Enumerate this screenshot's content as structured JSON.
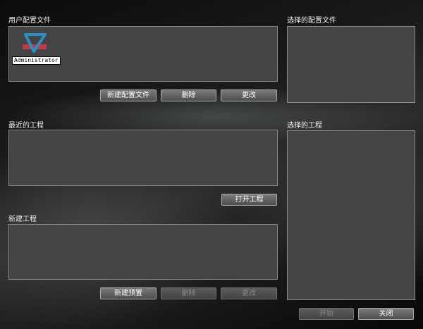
{
  "user_profiles": {
    "label": "用户配置文件",
    "profiles": [
      {
        "name": "Administrator",
        "icon": "playback-logo-icon"
      }
    ],
    "buttons": {
      "new_profile": "新建配置文件",
      "delete": "删除",
      "edit": "更改"
    }
  },
  "selected_profile": {
    "label": "选择的配置文件"
  },
  "recent_projects": {
    "label": "最近的工程",
    "buttons": {
      "open_project": "打开工程"
    }
  },
  "new_project": {
    "label": "新建工程",
    "buttons": {
      "new_preset": "新建预置",
      "delete": "删除",
      "edit": "更改"
    }
  },
  "selected_project": {
    "label": "选择的工程"
  },
  "footer": {
    "start": "开始",
    "close": "关闭"
  },
  "colors": {
    "panel_bg": "#444444",
    "panel_border": "#8a8a8a",
    "logo_blue": "#2a8fc4",
    "logo_red": "#c23a4a"
  }
}
